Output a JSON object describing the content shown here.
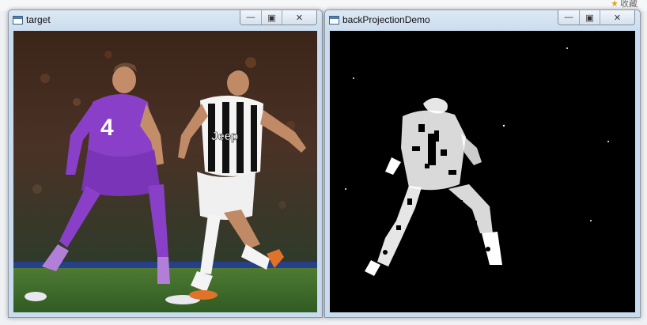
{
  "window_left": {
    "title": "target",
    "controls": {
      "minimize": "—",
      "maximize": "▣",
      "close": "✕"
    },
    "image_description": "soccer-players-photo"
  },
  "window_right": {
    "title": "backProjectionDemo",
    "controls": {
      "minimize": "—",
      "maximize": "▣",
      "close": "✕"
    }
  },
  "background": {
    "favorites_label": "收藏"
  },
  "colors": {
    "titlebar": "#c9dbee",
    "purple_kit": "#8a3fc8",
    "pitch_green": "#3c6a2a",
    "backprojection_bg": "#000000"
  }
}
